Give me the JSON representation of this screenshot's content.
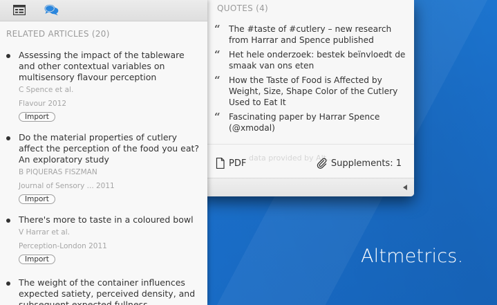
{
  "related": {
    "title": "RELATED ARTICLES (20)",
    "import_label": "Import",
    "articles": [
      {
        "title": "Assessing the impact of the tableware and other contextual variables on multisensory flavour perception",
        "authors": "C Spence et al.",
        "journal": "Flavour 2012",
        "has_import": true
      },
      {
        "title": "Do the material properties of cutlery affect the perception of the food you eat? An exploratory study",
        "authors": "B PIQUERAS FISZMAN",
        "journal": "Journal of Sensory ... 2011",
        "has_import": true
      },
      {
        "title": "There's more to taste in a coloured bowl",
        "authors": "V Harrar et al.",
        "journal": "Perception-London 2011",
        "has_import": true
      },
      {
        "title": "The weight of the container influences expected satiety, perceived density, and subsequent expected fullness",
        "authors": "",
        "journal": "",
        "has_import": false
      }
    ]
  },
  "tabs": [
    {
      "icon": "article-list-icon",
      "active": false
    },
    {
      "icon": "speech-bubbles-icon",
      "active": true
    }
  ],
  "quotes": {
    "title": "QUOTES (4)",
    "items": [
      "The #taste of #cutlery – new research from Harrar and Spence published",
      "Het hele onderzoek: bestek beïnvloedt de smaak van ons eten",
      "How the Taste of Food is Affected by Weight, Size, Shape Color of the Cutlery Used to Eat It",
      "Fascinating paper by Harrar Spence (@xmodal)"
    ],
    "watermark": "data provided by Alt..."
  },
  "footer": {
    "pdf_label": "PDF",
    "supplements_label": "Supplements: 1"
  },
  "brand": "Altmetrics.",
  "colors": {
    "accent_blue": "#2a86dd",
    "background_blue": "#1a6fca"
  }
}
